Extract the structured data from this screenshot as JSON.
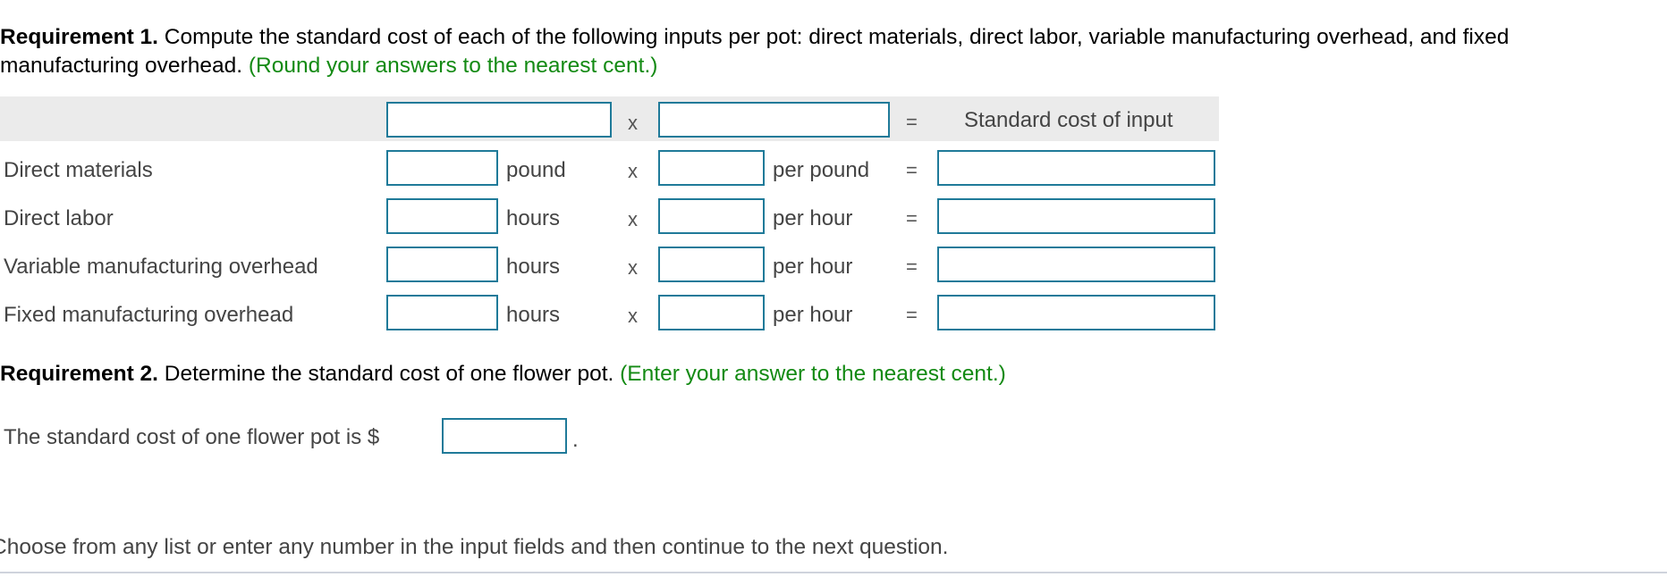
{
  "requirement1": {
    "label": "Requirement 1.",
    "text": " Compute the standard cost of each of the following inputs per pot: direct materials, direct labor, variable manufacturing overhead, and fixed manufacturing overhead.",
    "hint": " (Round your answers to the nearest cent.)"
  },
  "table": {
    "header": {
      "quantity_input": "",
      "times_symbol": "x",
      "price_input": "",
      "equals_symbol": "=",
      "result_label": "Standard cost of input"
    },
    "rows": [
      {
        "label": "Direct materials",
        "quantity": "",
        "quantity_unit": "pound",
        "times": "x",
        "price": "",
        "price_unit": "per pound",
        "equals": "=",
        "cost": ""
      },
      {
        "label": "Direct labor",
        "quantity": "",
        "quantity_unit": "hours",
        "times": "x",
        "price": "",
        "price_unit": "per hour",
        "equals": "=",
        "cost": ""
      },
      {
        "label": "Variable manufacturing overhead",
        "quantity": "",
        "quantity_unit": "hours",
        "times": "x",
        "price": "",
        "price_unit": "per hour",
        "equals": "=",
        "cost": ""
      },
      {
        "label": "Fixed manufacturing overhead",
        "quantity": "",
        "quantity_unit": "hours",
        "times": "x",
        "price": "",
        "price_unit": "per hour",
        "equals": "=",
        "cost": ""
      }
    ]
  },
  "requirement2": {
    "label": "Requirement 2.",
    "text": " Determine the standard cost of one flower pot.",
    "hint": " (Enter your answer to the nearest cent.)",
    "answer_prefix": "The standard cost of one flower pot is $",
    "answer_value": "",
    "answer_suffix": "."
  },
  "footer": {
    "instruction": "Choose from any list or enter any number in the input fields and then continue to the next question."
  },
  "colors": {
    "input_border": "#1f7a99",
    "hint_green": "#138a13",
    "header_band": "#ebebeb"
  }
}
